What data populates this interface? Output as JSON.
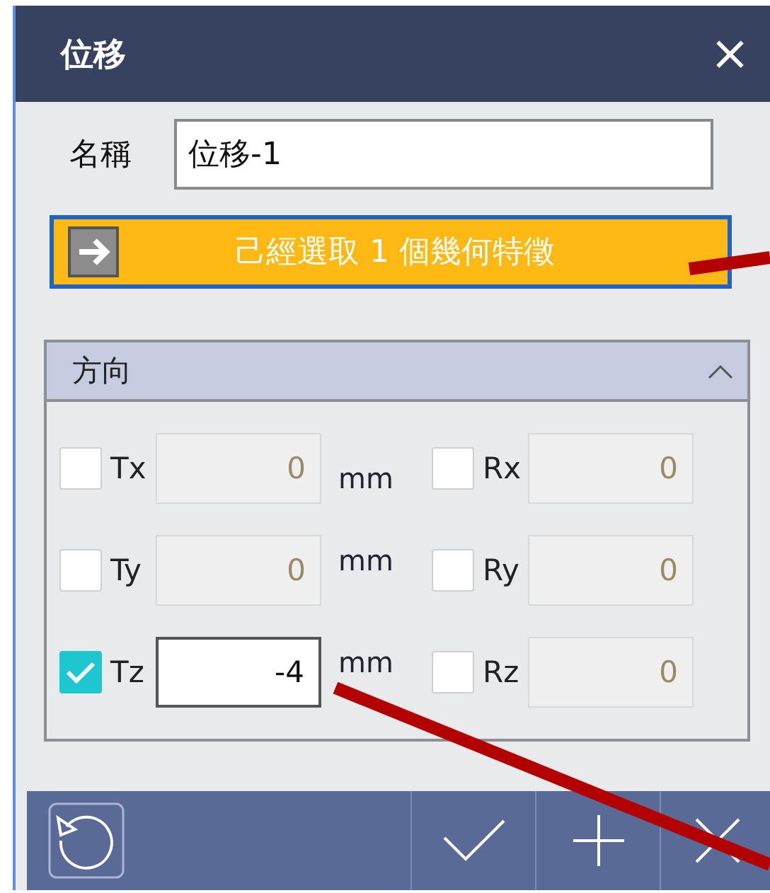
{
  "window": {
    "title": "位移",
    "close": "×"
  },
  "name_field": {
    "label": "名稱",
    "value": "位移-1"
  },
  "selection_button": {
    "label": "己經選取 1 個幾何特徵"
  },
  "direction_section": {
    "title": "方向",
    "expanded": true,
    "rows": [
      {
        "translation": {
          "label": "Tx",
          "checked": false,
          "value": "0",
          "unit": "mm"
        },
        "rotation": {
          "label": "Rx",
          "checked": false,
          "value": "0"
        }
      },
      {
        "translation": {
          "label": "Ty",
          "checked": false,
          "value": "0",
          "unit": "mm"
        },
        "rotation": {
          "label": "Ry",
          "checked": false,
          "value": "0"
        }
      },
      {
        "translation": {
          "label": "Tz",
          "checked": true,
          "value": "-4",
          "unit": "mm"
        },
        "rotation": {
          "label": "Rz",
          "checked": false,
          "value": "0"
        }
      }
    ]
  },
  "annotations": [
    {
      "kind": "leader-line"
    },
    {
      "kind": "leader-line"
    }
  ]
}
